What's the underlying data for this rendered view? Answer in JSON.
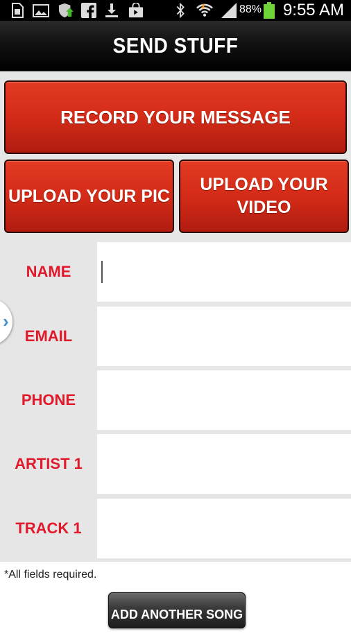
{
  "status_bar": {
    "battery_percent": "88%",
    "time": "9:55 AM",
    "icons": [
      "sim-icon",
      "image-icon",
      "shield-update-icon",
      "facebook-icon",
      "download-icon",
      "shopping-bag-icon",
      "bluetooth-icon",
      "wifi-icon",
      "signal-icon",
      "battery-icon"
    ]
  },
  "header": {
    "title": "SEND STUFF"
  },
  "actions": {
    "record_label": "RECORD YOUR MESSAGE",
    "upload_pic_label": "UPLOAD YOUR PIC",
    "upload_video_line1": "UPLOAD YOUR",
    "upload_video_line2": "VIDEO"
  },
  "form": {
    "fields": [
      {
        "label": "NAME",
        "value": ""
      },
      {
        "label": "EMAIL",
        "value": ""
      },
      {
        "label": "PHONE",
        "value": ""
      },
      {
        "label": "ARTIST 1",
        "value": ""
      },
      {
        "label": "TRACK 1",
        "value": ""
      }
    ],
    "note": "*All fields required.",
    "add_song_label": "ADD ANOTHER SONG"
  },
  "colors": {
    "accent_red": "#d42b18",
    "label_red": "#e0192b",
    "panel_grey": "#e6e6e6",
    "chevron_blue": "#4a90c8"
  }
}
